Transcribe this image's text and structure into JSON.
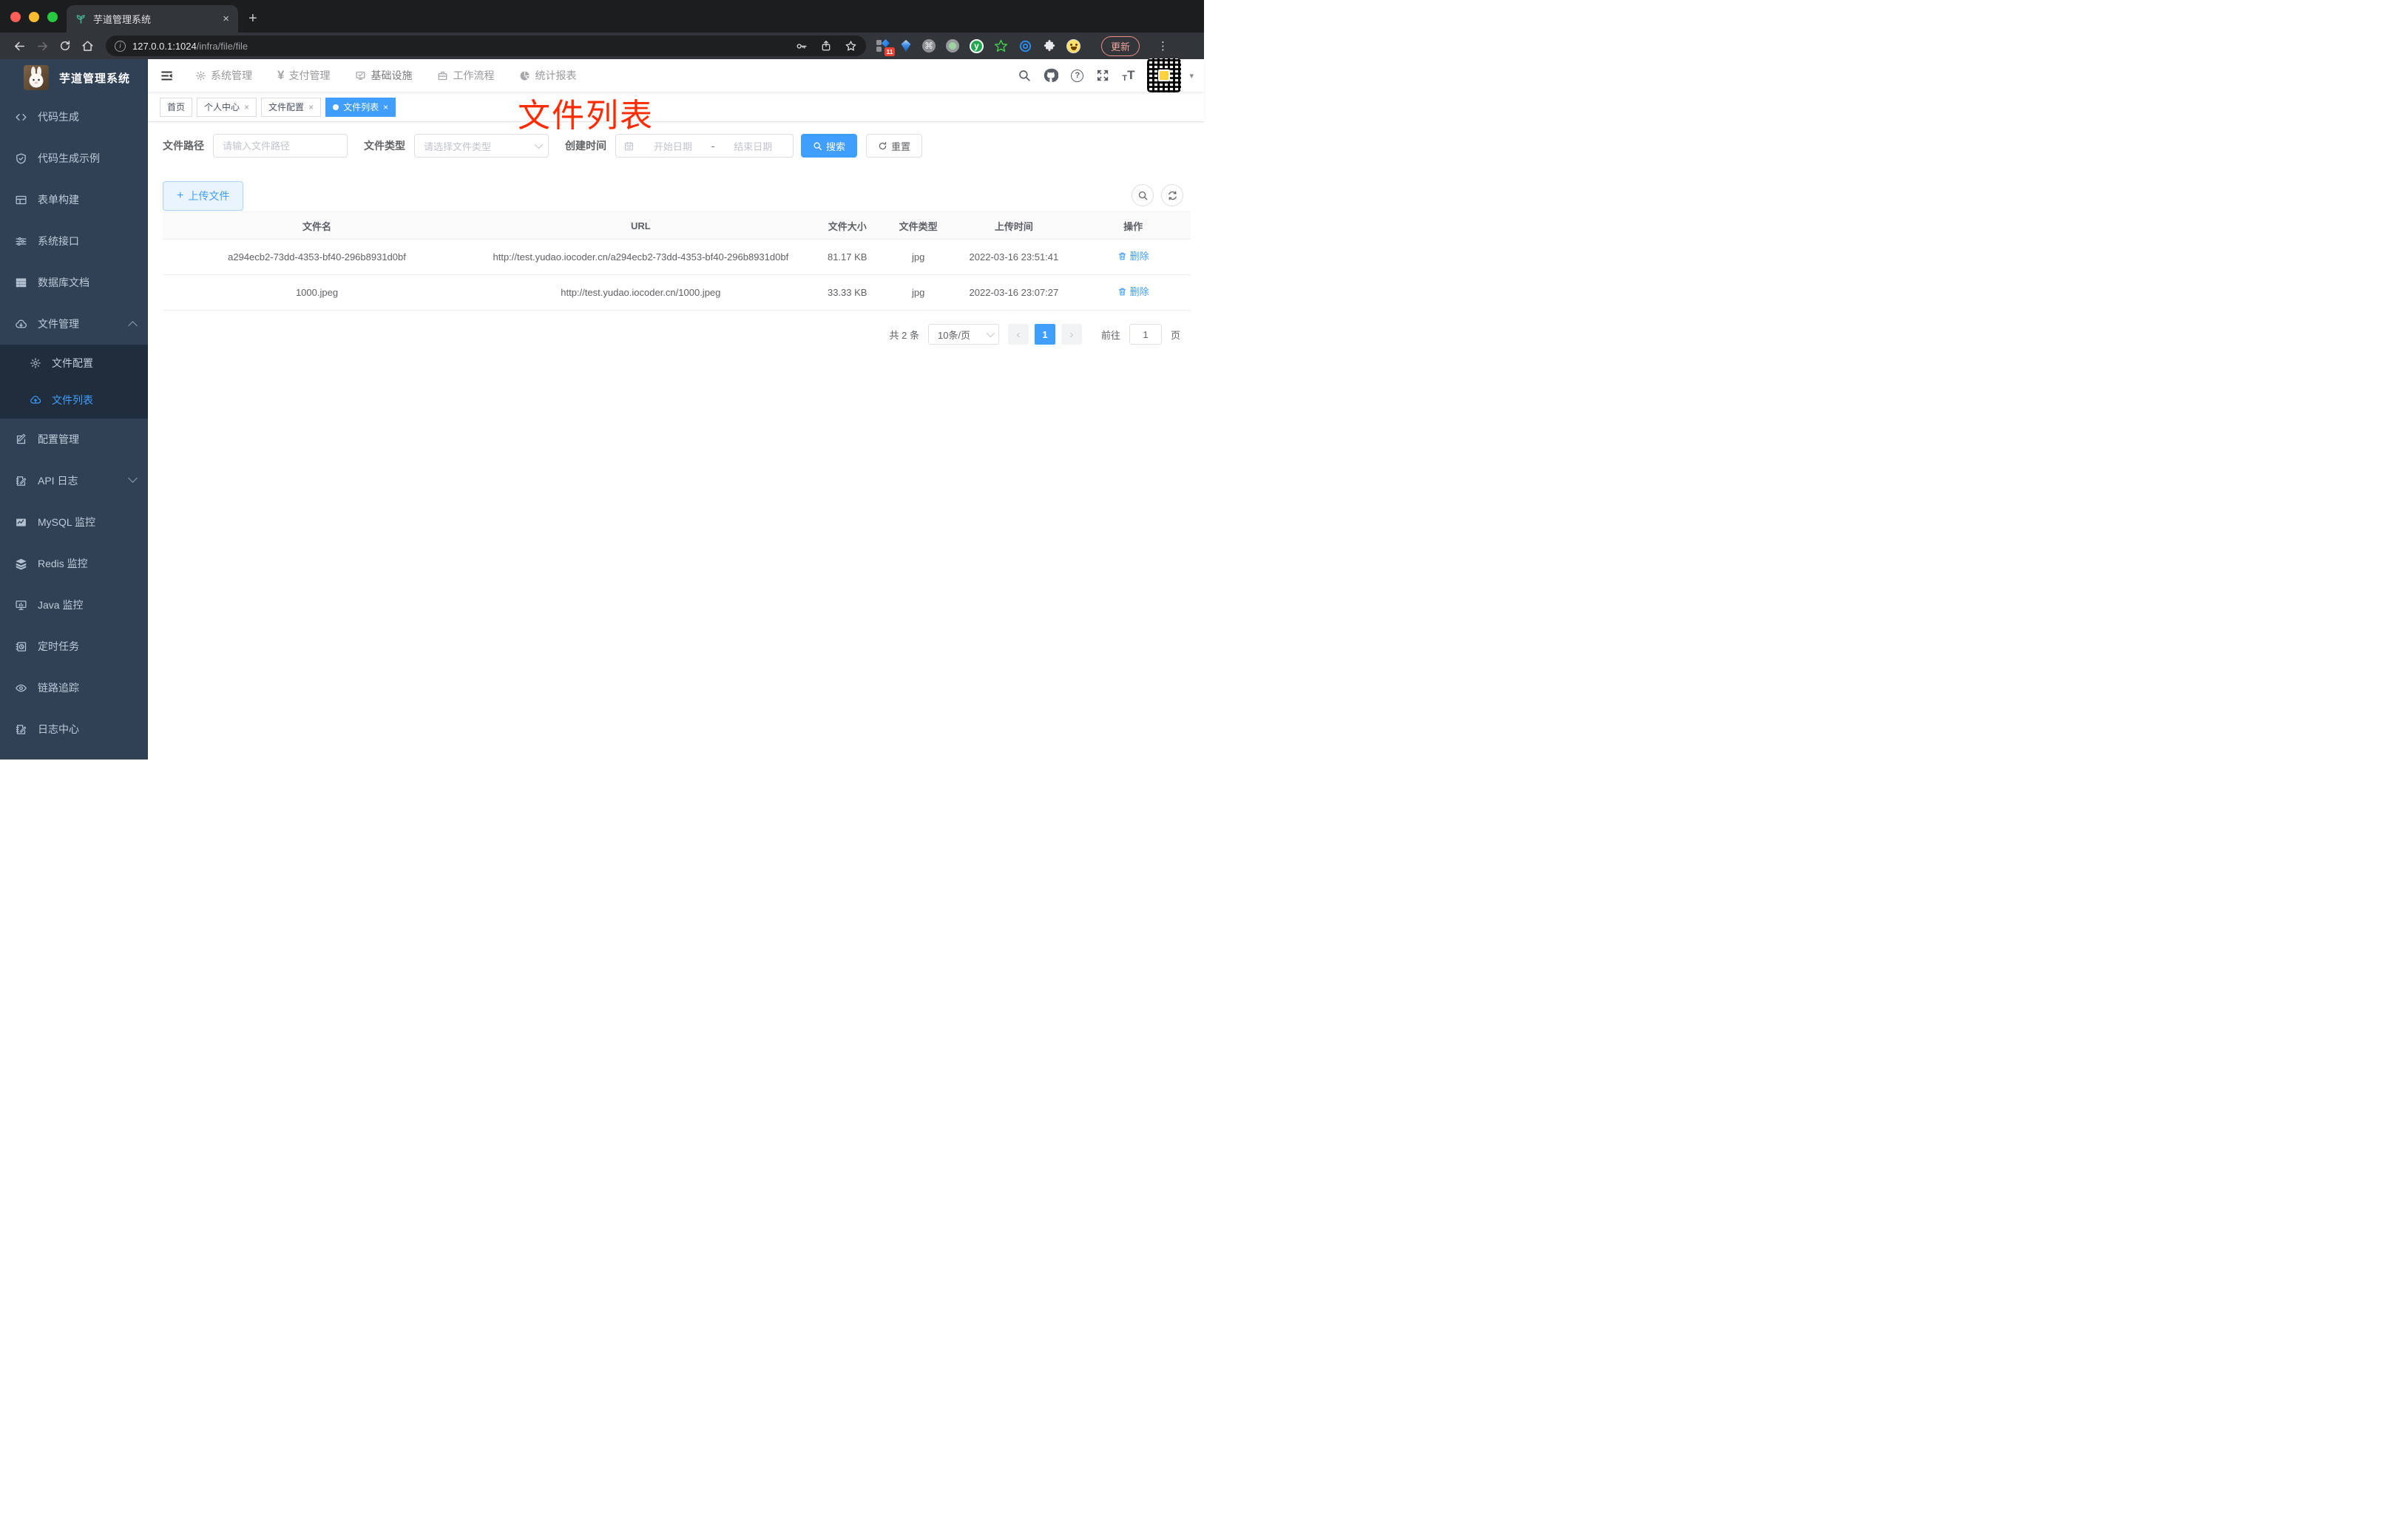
{
  "browser": {
    "tab_title": "芋道管理系统",
    "url_host": "127.0.0.1:1024",
    "url_path": "/infra/file/file",
    "update_button": "更新",
    "extension_badge": "11"
  },
  "glyphs": {
    "close": "×",
    "plus": "+",
    "prev": "‹",
    "next": "›",
    "caret_down": "▾",
    "command": "⌘",
    "dots": "⋮",
    "yen": "¥",
    "question": "?",
    "info": "i",
    "font_small": "T",
    "font_big": "T",
    "letter_y": "y",
    "dash": "-"
  },
  "topnav": {
    "items": [
      {
        "label": "系统管理"
      },
      {
        "label": "支付管理"
      },
      {
        "label": "基础设施"
      },
      {
        "label": "工作流程"
      },
      {
        "label": "统计报表"
      }
    ]
  },
  "sidebar": {
    "title": "芋道管理系统",
    "items": [
      {
        "label": "代码生成"
      },
      {
        "label": "代码生成示例"
      },
      {
        "label": "表单构建"
      },
      {
        "label": "系统接口"
      },
      {
        "label": "数据库文档"
      },
      {
        "label": "文件管理"
      },
      {
        "label": "文件配置"
      },
      {
        "label": "文件列表"
      },
      {
        "label": "配置管理"
      },
      {
        "label": "API 日志"
      },
      {
        "label": "MySQL 监控"
      },
      {
        "label": "Redis 监控"
      },
      {
        "label": "Java 监控"
      },
      {
        "label": "定时任务"
      },
      {
        "label": "链路追踪"
      },
      {
        "label": "日志中心"
      }
    ]
  },
  "tags": [
    {
      "label": "首页"
    },
    {
      "label": "个人中心"
    },
    {
      "label": "文件配置"
    },
    {
      "label": "文件列表"
    }
  ],
  "annotation": {
    "text": "文件列表"
  },
  "filters": {
    "path_label": "文件路径",
    "path_placeholder": "请输入文件路径",
    "type_label": "文件类型",
    "type_placeholder": "请选择文件类型",
    "date_label": "创建时间",
    "date_start_placeholder": "开始日期",
    "date_end_placeholder": "结束日期",
    "search_button": "搜索",
    "reset_button": "重置"
  },
  "toolbar": {
    "upload_button": "上传文件"
  },
  "table": {
    "columns": [
      "文件名",
      "URL",
      "文件大小",
      "文件类型",
      "上传时间",
      "操作"
    ],
    "rows": [
      {
        "name": "a294ecb2-73dd-4353-bf40-296b8931d0bf",
        "url": "http://test.yudao.iocoder.cn/a294ecb2-73dd-4353-bf40-296b8931d0bf",
        "size": "81.17 KB",
        "type": "jpg",
        "time": "2022-03-16 23:51:41",
        "action": "删除"
      },
      {
        "name": "1000.jpeg",
        "url": "http://test.yudao.iocoder.cn/1000.jpeg",
        "size": "33.33 KB",
        "type": "jpg",
        "time": "2022-03-16 23:07:27",
        "action": "删除"
      }
    ]
  },
  "pagination": {
    "total": "共 2 条",
    "page_size": "10条/页",
    "current_page": "1",
    "goto_label": "前往",
    "goto_value": "1",
    "page_unit": "页"
  },
  "colors": {
    "accent": "#409eff",
    "sidebar_bg": "#304156",
    "submenu_bg": "#1f2d3d",
    "annotation_red": "#ff2b00",
    "active_tag_bg": "#409eff"
  }
}
